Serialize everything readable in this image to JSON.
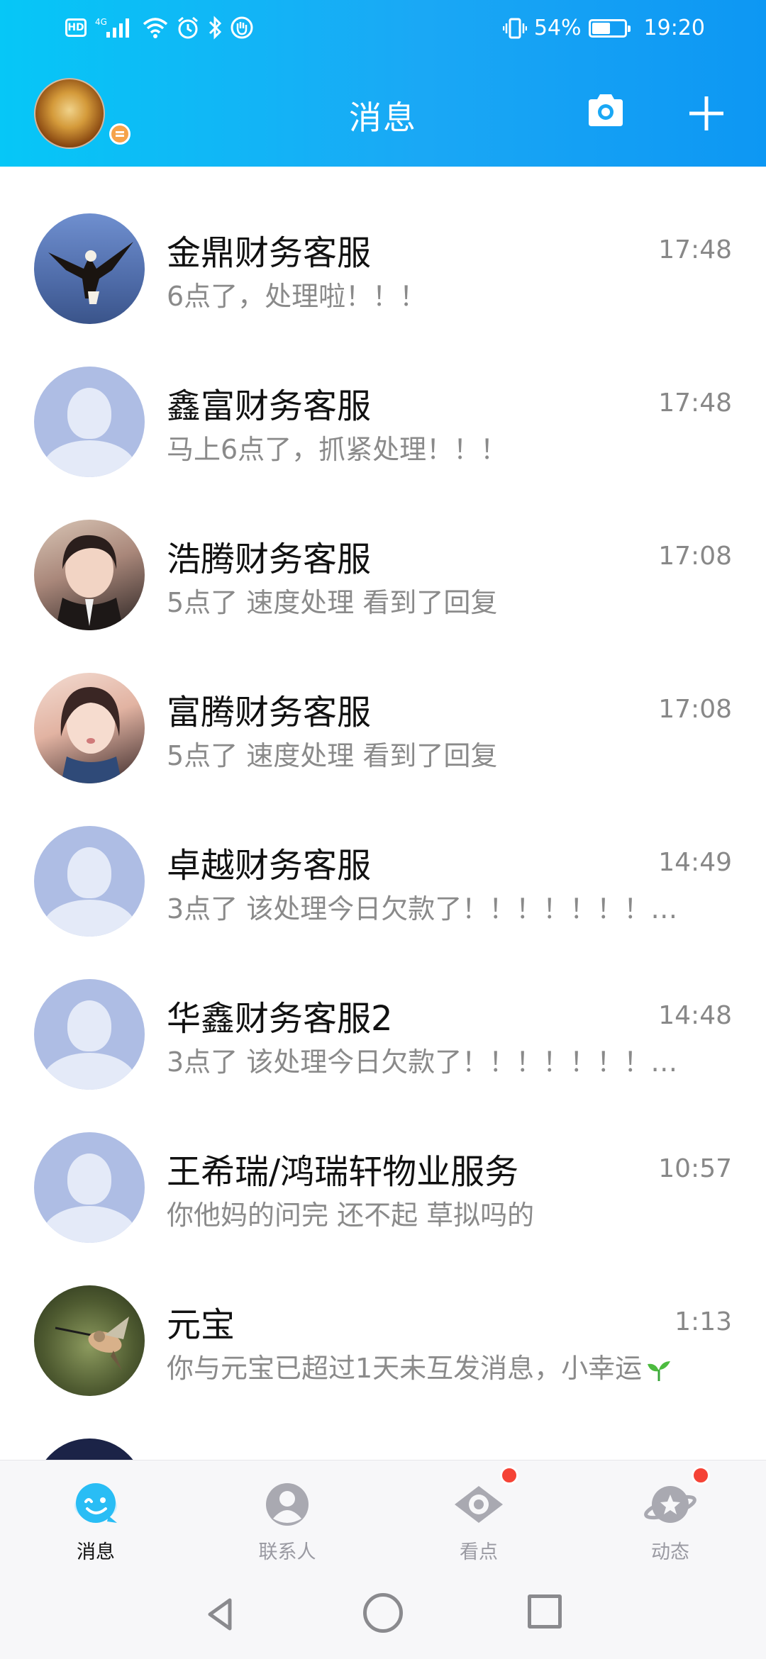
{
  "status_bar": {
    "network": "4G",
    "battery": "54%",
    "time": "19:20",
    "battery_level": 0.54,
    "icons": [
      "hd-icon",
      "signal-icon",
      "wifi-icon",
      "alarm-icon",
      "bluetooth-icon",
      "hand-icon",
      "vibrate-icon",
      "battery-icon"
    ]
  },
  "header": {
    "title": "消息",
    "accent_gradient": [
      "#06c7f7",
      "#0d97f3"
    ]
  },
  "conversations": [
    {
      "name": "金鼎财务客服",
      "time": "17:48",
      "preview": "6点了，处理啦！！！",
      "avatar": "eagle"
    },
    {
      "name": "鑫富财务客服",
      "time": "17:48",
      "preview": "马上6点了，抓紧处理！！！",
      "avatar": "default"
    },
    {
      "name": "浩腾财务客服",
      "time": "17:08",
      "preview": "5点了   速度处理  看到了回复",
      "avatar": "photo-girl"
    },
    {
      "name": "富腾财务客服",
      "time": "17:08",
      "preview": "5点了   速度处理  看到了回复",
      "avatar": "photo-girl"
    },
    {
      "name": "卓越财务客服",
      "time": "14:49",
      "preview": "3点了  该处理今日欠款了！！！！！！！！！",
      "avatar": "default"
    },
    {
      "name": "华鑫财务客服2",
      "time": "14:48",
      "preview": "3点了  该处理今日欠款了！！！！！！！！！",
      "avatar": "default"
    },
    {
      "name": "王希瑞/鸿瑞轩物业服务",
      "time": "10:57",
      "preview": "你他妈的问完   还不起    草拟吗的",
      "avatar": "default"
    },
    {
      "name": "元宝",
      "time": "1:13",
      "preview": "你与元宝已超过1天未互发消息，小幸运",
      "avatar": "hummingbird"
    }
  ],
  "tabs": [
    {
      "label": "消息",
      "icon": "chat-icon",
      "active": true,
      "badge": false
    },
    {
      "label": "联系人",
      "icon": "contacts-icon",
      "active": false,
      "badge": false
    },
    {
      "label": "看点",
      "icon": "eye-icon",
      "active": false,
      "badge": true
    },
    {
      "label": "动态",
      "icon": "planet-icon",
      "active": false,
      "badge": true
    }
  ],
  "colors": {
    "badge": "#f54336",
    "default_avatar": "#aebde4",
    "preview_text": "#8a8a8a"
  }
}
